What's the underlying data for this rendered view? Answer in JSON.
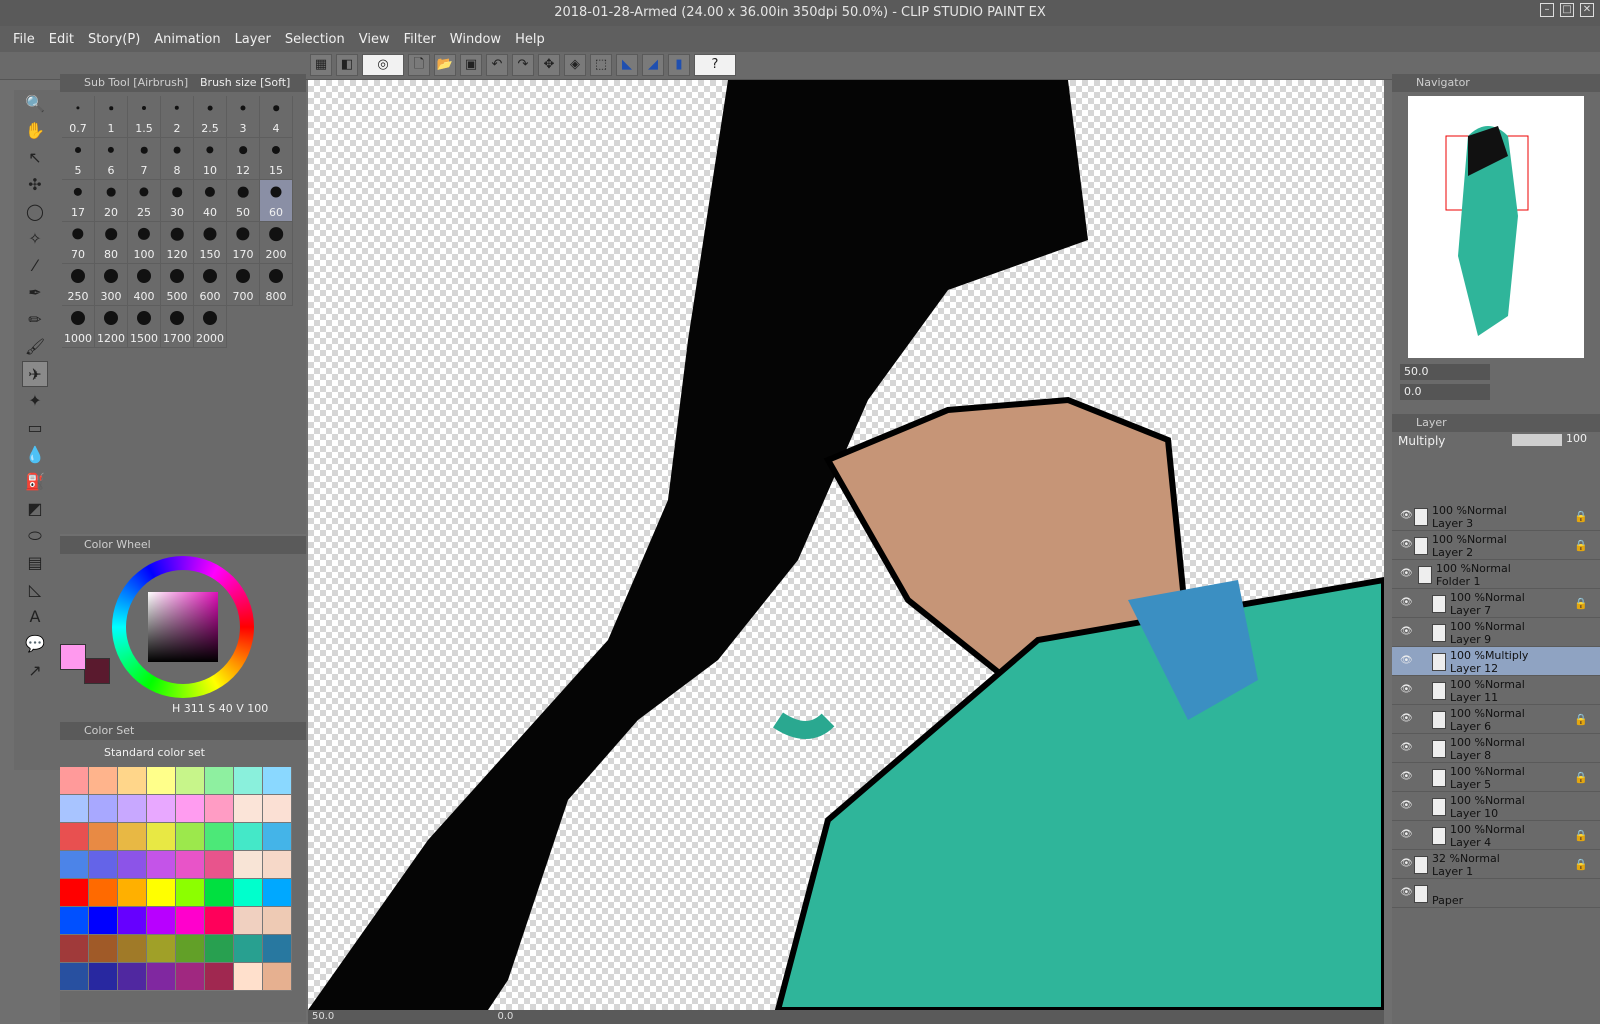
{
  "window": {
    "title": "2018-01-28-Armed (24.00 x 36.00in 350dpi 50.0%)  - CLIP STUDIO PAINT EX"
  },
  "menu": [
    "File",
    "Edit",
    "Story(P)",
    "Animation",
    "Layer",
    "Selection",
    "View",
    "Filter",
    "Window",
    "Help"
  ],
  "subtool": {
    "tab1": "Sub Tool [Airbrush]",
    "tab2": "Brush size [Soft]",
    "sizes": [
      "0.7",
      "1",
      "1.5",
      "2",
      "2.5",
      "3",
      "4",
      "5",
      "6",
      "7",
      "8",
      "10",
      "12",
      "15",
      "17",
      "20",
      "25",
      "30",
      "40",
      "50",
      "60",
      "70",
      "80",
      "100",
      "120",
      "150",
      "170",
      "200",
      "250",
      "300",
      "400",
      "500",
      "600",
      "700",
      "800",
      "1000",
      "1200",
      "1500",
      "1700",
      "2000"
    ],
    "selected": "60"
  },
  "colorwheel": {
    "tab": "Color Wheel",
    "h": "311",
    "s": "40",
    "v": "100",
    "main_color": "#ff99ee",
    "sub_color": "#5a1a2e"
  },
  "colorset": {
    "tab": "Color Set",
    "name": "Standard color set",
    "swatches": [
      "#ff9a9a",
      "#ffb48c",
      "#ffd68a",
      "#ffff8a",
      "#c7f58a",
      "#8ef0a0",
      "#8af0dc",
      "#8ad8ff",
      "#a8c4ff",
      "#a8a8ff",
      "#c8a8ff",
      "#e8a8ff",
      "#ff9cf0",
      "#ff9cc4",
      "#fbe4d8",
      "#fbe0d4",
      "#e85050",
      "#e88a44",
      "#e8b844",
      "#e8e844",
      "#9ce84c",
      "#4ce878",
      "#44e8c8",
      "#44b4e8",
      "#4c84e8",
      "#6464e8",
      "#8c54e8",
      "#c454e8",
      "#e854c8",
      "#e8548c",
      "#f8e4d6",
      "#f6d8c8",
      "#ff0000",
      "#ff6a00",
      "#ffb000",
      "#ffff00",
      "#8cff00",
      "#00e040",
      "#00ffcc",
      "#00a8ff",
      "#0050ff",
      "#0000ff",
      "#6600ff",
      "#b800ff",
      "#ff00cc",
      "#ff005a",
      "#f0d0c0",
      "#eecab4",
      "#a03a3a",
      "#a05a28",
      "#a07a28",
      "#a0a028",
      "#62a028",
      "#28a050",
      "#28a090",
      "#2878a0",
      "#2850a0",
      "#2828a0",
      "#5028a0",
      "#8028a0",
      "#a02880",
      "#a02850",
      "#ffe0cc",
      "#e6b090"
    ]
  },
  "navigator": {
    "tab": "Navigator",
    "zoom": "50.0",
    "rotate": "0.0"
  },
  "layer": {
    "tab": "Layer",
    "blend_mode": "Multiply",
    "opacity": "100",
    "items": [
      {
        "pct": "100 %Normal",
        "name": "Layer 3",
        "locked": true,
        "indent": false,
        "selected": false
      },
      {
        "pct": "100 %Normal",
        "name": "Layer 2",
        "locked": true,
        "indent": false,
        "selected": false
      },
      {
        "pct": "100 %Normal",
        "name": "Folder 1",
        "locked": false,
        "indent": false,
        "selected": false,
        "folder": true
      },
      {
        "pct": "100 %Normal",
        "name": "Layer 7",
        "locked": true,
        "indent": true,
        "selected": false
      },
      {
        "pct": "100 %Normal",
        "name": "Layer 9",
        "locked": false,
        "indent": true,
        "selected": false
      },
      {
        "pct": "100 %Multiply",
        "name": "Layer 12",
        "locked": false,
        "indent": true,
        "selected": true
      },
      {
        "pct": "100 %Normal",
        "name": "Layer 11",
        "locked": false,
        "indent": true,
        "selected": false
      },
      {
        "pct": "100 %Normal",
        "name": "Layer 6",
        "locked": true,
        "indent": true,
        "selected": false
      },
      {
        "pct": "100 %Normal",
        "name": "Layer 8",
        "locked": false,
        "indent": true,
        "selected": false
      },
      {
        "pct": "100 %Normal",
        "name": "Layer 5",
        "locked": true,
        "indent": true,
        "selected": false
      },
      {
        "pct": "100 %Normal",
        "name": "Layer 10",
        "locked": false,
        "indent": true,
        "selected": false
      },
      {
        "pct": "100 %Normal",
        "name": "Layer 4",
        "locked": true,
        "indent": true,
        "selected": false
      },
      {
        "pct": "32 %Normal",
        "name": "Layer 1",
        "locked": true,
        "indent": false,
        "selected": false
      },
      {
        "pct": "",
        "name": "Paper",
        "locked": false,
        "indent": false,
        "selected": false
      }
    ]
  },
  "status": {
    "zoom": "50.0",
    "rotate": "0.0"
  }
}
